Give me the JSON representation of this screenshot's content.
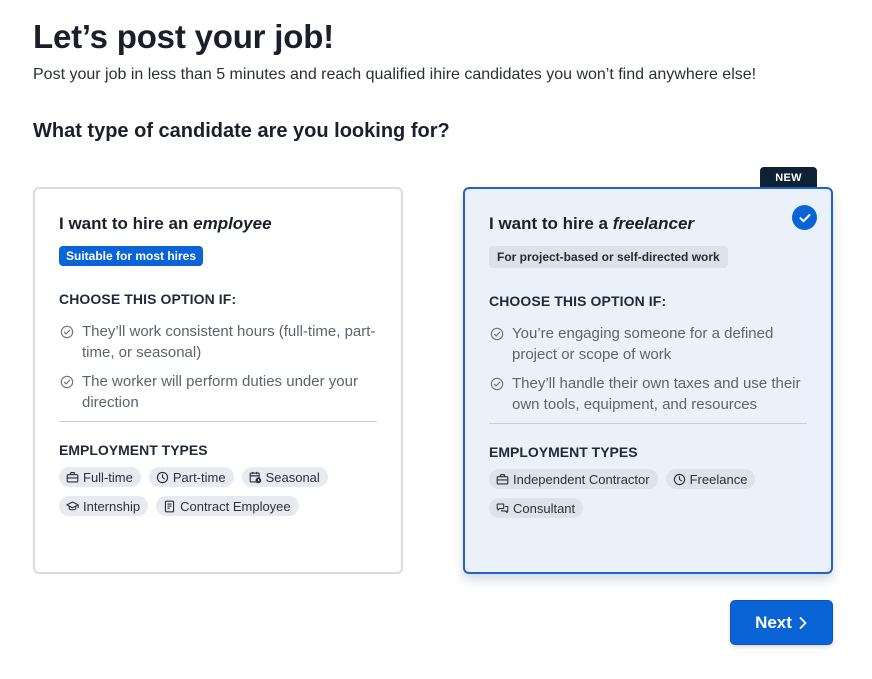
{
  "header": {
    "title": "Let’s post your job!",
    "subtitle": "Post your job in less than 5 minutes and reach qualified ihire candidates you won’t find anywhere else!",
    "question": "What type of candidate are you looking for?"
  },
  "options": [
    {
      "title_prefix": "I want to hire an ",
      "title_emphasis": "employee",
      "tag": "Suitable for most hires",
      "selected": false,
      "criteria_heading": "CHOOSE THIS OPTION IF:",
      "criteria": [
        "They’ll work consistent hours (full-time, part-time, or seasonal)",
        "The worker will perform duties under your direction"
      ],
      "types_heading": "EMPLOYMENT TYPES",
      "types": [
        {
          "label": "Full-time",
          "icon": "briefcase-icon"
        },
        {
          "label": "Part-time",
          "icon": "clock-icon"
        },
        {
          "label": "Seasonal",
          "icon": "calendar-clock-icon"
        },
        {
          "label": "Internship",
          "icon": "graduation-cap-icon"
        },
        {
          "label": "Contract Employee",
          "icon": "contract-icon"
        }
      ]
    },
    {
      "title_prefix": "I want to hire a ",
      "title_emphasis": "freelancer",
      "tag": "For project-based or self-directed work",
      "badge": "NEW",
      "selected": true,
      "criteria_heading": "CHOOSE THIS OPTION IF:",
      "criteria": [
        "You’re engaging someone for a defined project or scope of work",
        "They’ll handle their own taxes and use their own tools, equipment, and resources"
      ],
      "types_heading": "EMPLOYMENT TYPES",
      "types": [
        {
          "label": "Independent Contractor",
          "icon": "briefcase-icon"
        },
        {
          "label": "Freelance",
          "icon": "clock-icon"
        },
        {
          "label": "Consultant",
          "icon": "chat-bubbles-icon"
        }
      ]
    }
  ],
  "actions": {
    "next_label": "Next"
  },
  "colors": {
    "primary": "#0b64d6",
    "selected_card_bg": "#eaf1fb",
    "badge_bg": "#0e2233"
  }
}
